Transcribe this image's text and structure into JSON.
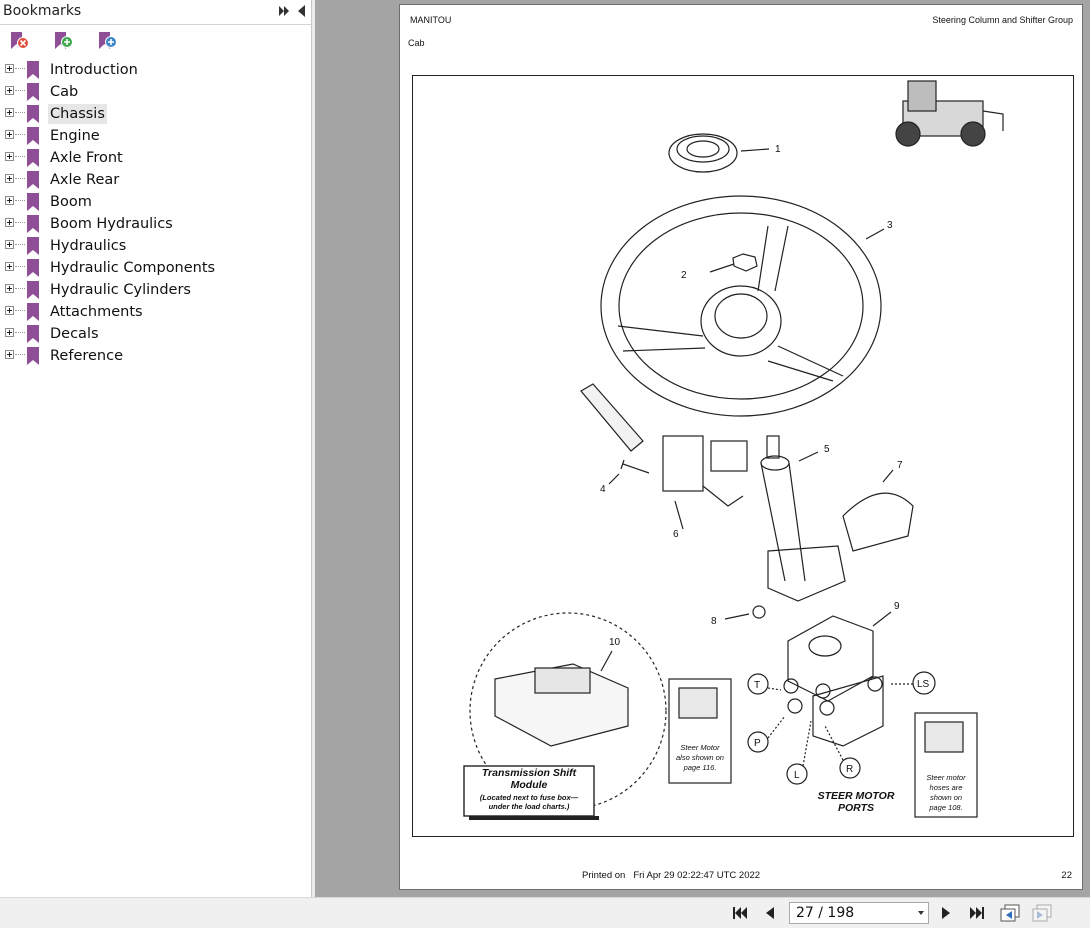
{
  "bookmarks_panel": {
    "title": "Bookmarks",
    "toolbar": {
      "delete_icon": "bookmark-delete-icon",
      "add_icon": "bookmark-add-icon",
      "properties_icon": "bookmark-properties-icon"
    },
    "items": [
      {
        "label": "Introduction",
        "selected": false
      },
      {
        "label": "Cab",
        "selected": false
      },
      {
        "label": "Chassis",
        "selected": true
      },
      {
        "label": "Engine",
        "selected": false
      },
      {
        "label": "Axle Front",
        "selected": false
      },
      {
        "label": "Axle Rear",
        "selected": false
      },
      {
        "label": "Boom",
        "selected": false
      },
      {
        "label": "Boom Hydraulics",
        "selected": false
      },
      {
        "label": "Hydraulics",
        "selected": false
      },
      {
        "label": "Hydraulic Components",
        "selected": false
      },
      {
        "label": "Hydraulic Cylinders",
        "selected": false
      },
      {
        "label": "Attachments",
        "selected": false
      },
      {
        "label": "Decals",
        "selected": false
      },
      {
        "label": "Reference",
        "selected": false
      }
    ]
  },
  "document_page": {
    "brand": "MANITOU",
    "section_title": "Steering Column and Shifter Group",
    "subsection": "Cab",
    "printed_label": "Printed on",
    "printed_date": "Fri Apr 29 02:22:47 UTC 2022",
    "page_number": "22",
    "diagram": {
      "callouts": [
        "1",
        "2",
        "3",
        "4",
        "5",
        "6",
        "7",
        "8",
        "9",
        "10"
      ],
      "port_labels": [
        "T",
        "P",
        "L",
        "R",
        "LS"
      ],
      "module_box": {
        "title_line1": "Transmission Shift",
        "title_line2": "Module",
        "note_line1": "(Located next to fuse box—",
        "note_line2": "under the load charts.)"
      },
      "steer_motor_note": [
        "Steer Motor",
        "also shown on",
        "page 116."
      ],
      "steer_hoses_note": [
        "Steer motor",
        "hoses are",
        "shown on",
        "page 108."
      ],
      "steer_ports_title": [
        "STEER MOTOR",
        "PORTS"
      ]
    }
  },
  "navigation": {
    "page_display": "27 / 198",
    "current_page": 27,
    "total_pages": 198
  },
  "colors": {
    "bookmark_flag": "#8e4f97",
    "viewer_background": "#a4a4a4",
    "selection": "#e6e6e6"
  }
}
